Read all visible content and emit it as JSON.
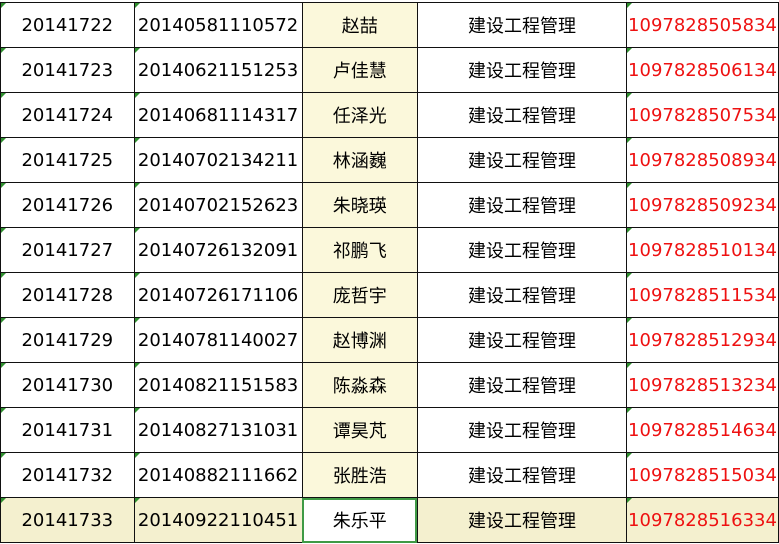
{
  "rows": [
    {
      "id": "20141722",
      "code": "20140581110572",
      "name": "赵喆",
      "major": "建设工程管理",
      "card": "1097828505834"
    },
    {
      "id": "20141723",
      "code": "20140621151253",
      "name": "卢佳慧",
      "major": "建设工程管理",
      "card": "1097828506134"
    },
    {
      "id": "20141724",
      "code": "20140681114317",
      "name": "任泽光",
      "major": "建设工程管理",
      "card": "1097828507534"
    },
    {
      "id": "20141725",
      "code": "20140702134211",
      "name": "林涵巍",
      "major": "建设工程管理",
      "card": "1097828508934"
    },
    {
      "id": "20141726",
      "code": "20140702152623",
      "name": "朱晓瑛",
      "major": "建设工程管理",
      "card": "1097828509234"
    },
    {
      "id": "20141727",
      "code": "20140726132091",
      "name": "祁鹏飞",
      "major": "建设工程管理",
      "card": "1097828510134"
    },
    {
      "id": "20141728",
      "code": "20140726171106",
      "name": "庞哲宇",
      "major": "建设工程管理",
      "card": "1097828511534"
    },
    {
      "id": "20141729",
      "code": "20140781140027",
      "name": "赵博渊",
      "major": "建设工程管理",
      "card": "1097828512934"
    },
    {
      "id": "20141730",
      "code": "20140821151583",
      "name": "陈淼森",
      "major": "建设工程管理",
      "card": "1097828513234"
    },
    {
      "id": "20141731",
      "code": "20140827131031",
      "name": "谭昊芃",
      "major": "建设工程管理",
      "card": "1097828514634"
    },
    {
      "id": "20141732",
      "code": "20140882111662",
      "name": "张胜浩",
      "major": "建设工程管理",
      "card": "1097828515034"
    },
    {
      "id": "20141733",
      "code": "20140922110451",
      "name": "朱乐平",
      "major": "建设工程管理",
      "card": "1097828516334"
    }
  ],
  "colors": {
    "text": "#000000",
    "card_text": "#ee1111",
    "name_column_fill": "#fbf8db",
    "selected_row_fill": "#f4f0cf",
    "selection_border": "#3f9a45",
    "error_marker": "#2f8f2f"
  }
}
